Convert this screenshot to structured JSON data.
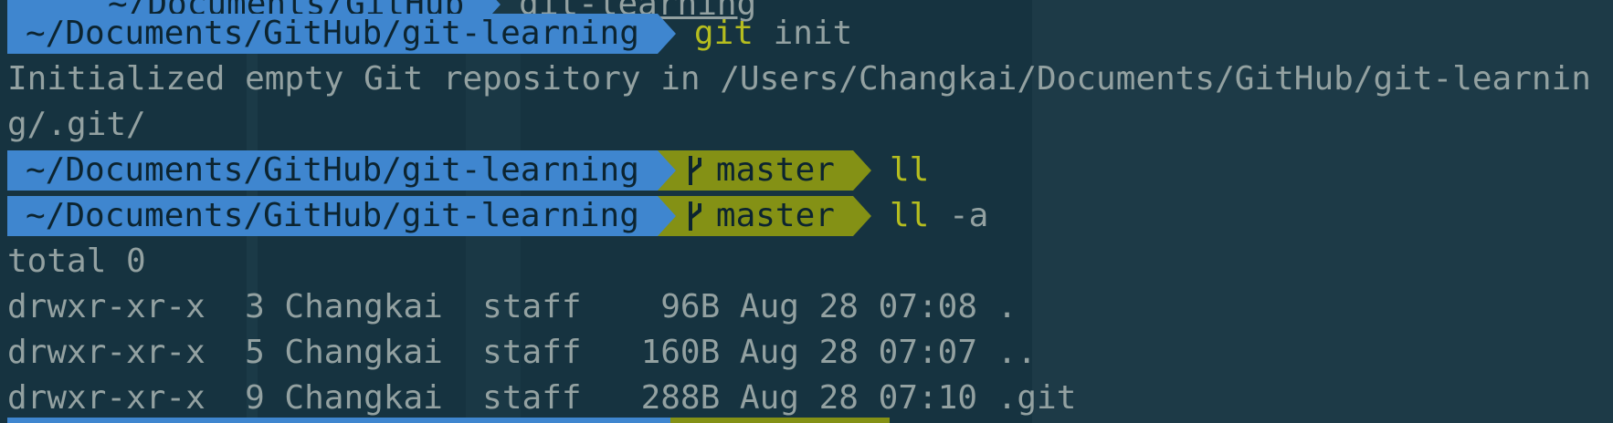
{
  "prompt": {
    "path": "~/Documents/GitHub/git-learning",
    "top_partial_path": "~/Documents/GitHub",
    "top_partial_repo": "git-learning",
    "branch": "master",
    "branch_icon": "git-branch-icon"
  },
  "commands": {
    "git_init": {
      "cmd": "git",
      "args": " init"
    },
    "ll": {
      "cmd": "ll",
      "args": ""
    },
    "ll_a": {
      "cmd": "ll",
      "args": " -a"
    }
  },
  "output": {
    "init_line1": "Initialized empty Git repository in /Users/Changkai/Documents/GitHub/git-learnin",
    "init_line2": "g/.git/",
    "total": "total 0",
    "listing": [
      {
        "text": "drwxr-xr-x  3 Changkai  staff    96B Aug 28 07:08 ."
      },
      {
        "text": "drwxr-xr-x  5 Changkai  staff   160B Aug 28 07:07 .."
      },
      {
        "text": "drwxr-xr-x  9 Changkai  staff   288B Aug 28 07:10 .git"
      }
    ]
  },
  "colors": {
    "background": "#163340",
    "dir_segment": "#3f86cf",
    "git_segment": "#849115",
    "command": "#b5bd1f",
    "text": "#93a1a1"
  }
}
